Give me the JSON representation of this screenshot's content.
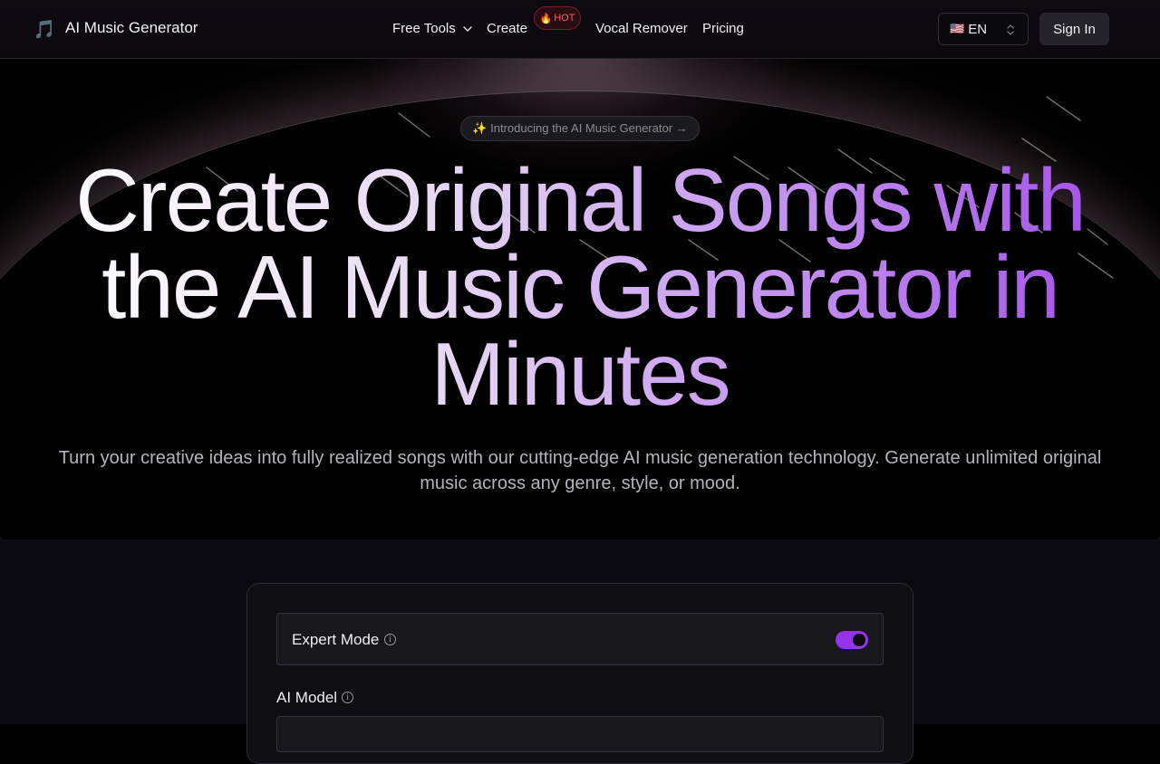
{
  "header": {
    "brand": "AI Music Generator",
    "logo_icon": "music-note-icon",
    "nav": {
      "free_tools": "Free Tools",
      "create": "Create",
      "hot_badge": "HOT",
      "vocal_remover": "Vocal Remover",
      "pricing": "Pricing"
    },
    "language": {
      "flag": "🇺🇸",
      "code": "EN"
    },
    "sign_in": "Sign In"
  },
  "hero": {
    "intro_pill": "✨ Introducing the AI Music Generator →",
    "headline": "Create Original Songs with the AI Music Generator in Minutes",
    "subheadline": "Turn your creative ideas into fully realized songs with our cutting-edge AI music generation technology. Generate unlimited original music across any genre, style, or mood."
  },
  "form": {
    "expert_mode_label": "Expert Mode",
    "expert_mode_on": true,
    "ai_model_label": "AI Model"
  },
  "colors": {
    "accent": "#9333ea",
    "hot_badge": "#ff5a6a",
    "background": "#000000"
  }
}
